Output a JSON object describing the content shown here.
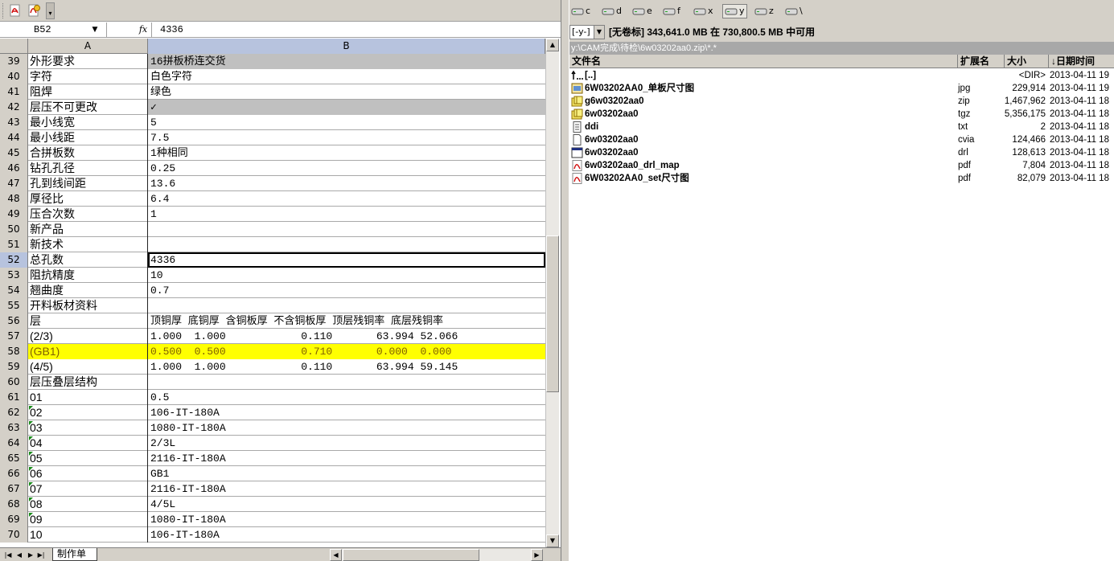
{
  "toolbar": {
    "icons": [
      "pdf-icon",
      "pdf-settings-icon"
    ]
  },
  "formula_bar": {
    "name_box": "B52",
    "fx": "fx",
    "value": "4336"
  },
  "columns": [
    "A",
    "B"
  ],
  "rows": [
    {
      "num": "39",
      "a": "外形要求",
      "b": "16拼板桥连交货",
      "style": "gray",
      "mark": false
    },
    {
      "num": "40",
      "a": "字符",
      "b": "白色字符",
      "style": "",
      "mark": false
    },
    {
      "num": "41",
      "a": "阻焊",
      "b": "绿色",
      "style": "",
      "mark": false
    },
    {
      "num": "42",
      "a": "层压不可更改",
      "b": "✓",
      "style": "gray",
      "mark": false
    },
    {
      "num": "43",
      "a": "最小线宽",
      "b": "5",
      "style": "",
      "mark": false
    },
    {
      "num": "44",
      "a": "最小线距",
      "b": "7.5",
      "style": "",
      "mark": false
    },
    {
      "num": "45",
      "a": "合拼板数",
      "b": "1种相同",
      "style": "",
      "mark": false
    },
    {
      "num": "46",
      "a": "钻孔孔径",
      "b": "0.25",
      "style": "",
      "mark": false
    },
    {
      "num": "47",
      "a": "孔到线间距",
      "b": "13.6",
      "style": "",
      "mark": false
    },
    {
      "num": "48",
      "a": "厚径比",
      "b": "6.4",
      "style": "",
      "mark": false
    },
    {
      "num": "49",
      "a": "压合次数",
      "b": "1",
      "style": "",
      "mark": false
    },
    {
      "num": "50",
      "a": "新产品",
      "b": "",
      "style": "",
      "mark": false
    },
    {
      "num": "51",
      "a": "新技术",
      "b": "",
      "style": "",
      "mark": false
    },
    {
      "num": "52",
      "a": "总孔数",
      "b": "4336",
      "style": "active",
      "mark": false
    },
    {
      "num": "53",
      "a": "阻抗精度",
      "b": "10",
      "style": "",
      "mark": false
    },
    {
      "num": "54",
      "a": "翘曲度",
      "b": "0.7",
      "style": "",
      "mark": false
    },
    {
      "num": "55",
      "a": "开料板材资料",
      "b": "",
      "style": "",
      "mark": false
    },
    {
      "num": "56",
      "a": "层",
      "b": "顶铜厚 底铜厚 含铜板厚 不含铜板厚 顶层残铜率 底层残铜率",
      "style": "",
      "mark": false
    },
    {
      "num": "57",
      "a": "(2/3)",
      "b": "1.000  1.000            0.110       63.994 52.066",
      "style": "",
      "mark": false
    },
    {
      "num": "58",
      "a": "(GB1)",
      "b": "0.500  0.500            0.710       0.000  0.000",
      "style": "yellow",
      "mark": false
    },
    {
      "num": "59",
      "a": "(4/5)",
      "b": "1.000  1.000            0.110       63.994 59.145",
      "style": "",
      "mark": false
    },
    {
      "num": "60",
      "a": "层压叠层结构",
      "b": "",
      "style": "",
      "mark": false
    },
    {
      "num": "61",
      "a": "01",
      "b": "0.5",
      "style": "",
      "mark": false
    },
    {
      "num": "62",
      "a": "02",
      "b": "106-IT-180A",
      "style": "",
      "mark": true
    },
    {
      "num": "63",
      "a": "03",
      "b": "1080-IT-180A",
      "style": "",
      "mark": true
    },
    {
      "num": "64",
      "a": "04",
      "b": "2/3L",
      "style": "",
      "mark": true
    },
    {
      "num": "65",
      "a": "05",
      "b": "2116-IT-180A",
      "style": "",
      "mark": true
    },
    {
      "num": "66",
      "a": "06",
      "b": "GB1",
      "style": "",
      "mark": true
    },
    {
      "num": "67",
      "a": "07",
      "b": "2116-IT-180A",
      "style": "",
      "mark": true
    },
    {
      "num": "68",
      "a": "08",
      "b": "4/5L",
      "style": "",
      "mark": true
    },
    {
      "num": "69",
      "a": "09",
      "b": "1080-IT-180A",
      "style": "",
      "mark": true
    },
    {
      "num": "70",
      "a": "10",
      "b": "106-IT-180A",
      "style": "",
      "mark": false
    }
  ],
  "sheet_tab": "制作单",
  "drives": [
    {
      "letter": "c",
      "selected": false
    },
    {
      "letter": "d",
      "selected": false
    },
    {
      "letter": "e",
      "selected": false
    },
    {
      "letter": "f",
      "selected": false
    },
    {
      "letter": "x",
      "selected": false
    },
    {
      "letter": "y",
      "selected": true
    },
    {
      "letter": "z",
      "selected": false
    },
    {
      "letter": "\\",
      "selected": false
    }
  ],
  "drive_combo": "[-y-]",
  "free_space": "[无卷标]  343,641.0 MB 在 730,800.5 MB 中可用",
  "current_path": "y:\\CAM完成\\待检\\6w03202aa0.zip\\*.*",
  "file_headers": {
    "name": "文件名",
    "ext": "扩展名",
    "size": "大小",
    "date": "↓日期时间"
  },
  "files": [
    {
      "icon": "parent-dir-icon",
      "name": "[..]",
      "ext": "",
      "size": "<DIR>",
      "date": "2013-04-11 19"
    },
    {
      "icon": "image-file-icon",
      "name": "6W03202AA0_单板尺寸图",
      "ext": "jpg",
      "size": "229,914",
      "date": "2013-04-11 19"
    },
    {
      "icon": "archive-icon",
      "name": "g6w03202aa0",
      "ext": "zip",
      "size": "1,467,962",
      "date": "2013-04-11 18"
    },
    {
      "icon": "archive-icon",
      "name": "6w03202aa0",
      "ext": "tgz",
      "size": "5,356,175",
      "date": "2013-04-11 18"
    },
    {
      "icon": "text-file-icon",
      "name": "ddi",
      "ext": "txt",
      "size": "2",
      "date": "2013-04-11 18"
    },
    {
      "icon": "file-icon",
      "name": "6w03202aa0",
      "ext": "cvia",
      "size": "124,466",
      "date": "2013-04-11 18"
    },
    {
      "icon": "app-window-icon",
      "name": "6w03202aa0",
      "ext": "drl",
      "size": "128,613",
      "date": "2013-04-11 18"
    },
    {
      "icon": "pdf-icon",
      "name": "6w03202aa0_drl_map",
      "ext": "pdf",
      "size": "7,804",
      "date": "2013-04-11 18"
    },
    {
      "icon": "pdf-icon",
      "name": "6W03202AA0_set尺寸图",
      "ext": "pdf",
      "size": "82,079",
      "date": "2013-04-11 18"
    }
  ],
  "colors": {
    "selection_yellow": "#ffff00",
    "header_gray": "#d4d0c8",
    "active_header": "#b7c3de",
    "path_bar": "#a8a8a8"
  }
}
